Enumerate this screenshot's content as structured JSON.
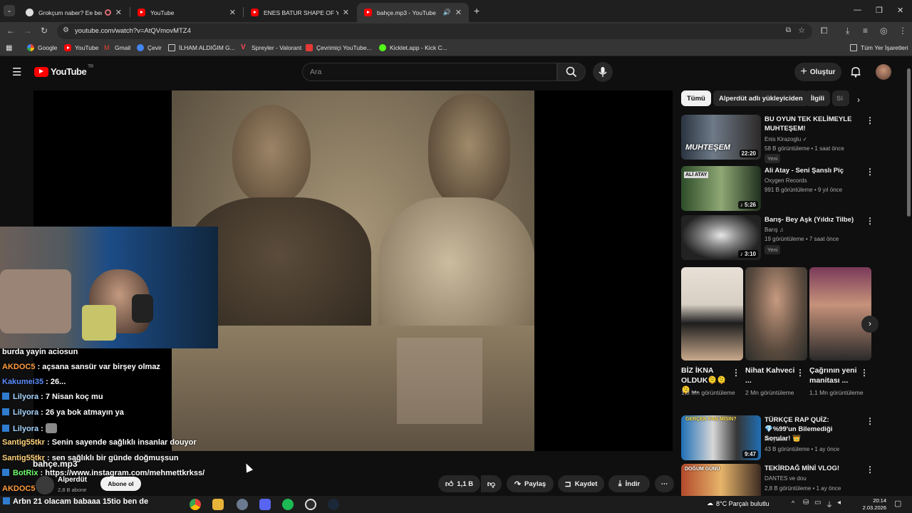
{
  "browser": {
    "tabs": [
      {
        "title": "Grokçum naber? Ee ben şim",
        "active": false
      },
      {
        "title": "YouTube",
        "active": false
      },
      {
        "title": "ENES BATUR SHAPE OF YOU RE",
        "active": false
      },
      {
        "title": "bahçe.mp3 - YouTube",
        "active": true
      }
    ],
    "url": "youtube.com/watch?v=AtQVmovMTZ4",
    "bookmarks": [
      {
        "label": "Google"
      },
      {
        "label": "YouTube"
      },
      {
        "label": "Gmail"
      },
      {
        "label": "Çevir"
      },
      {
        "label": "İLHAM ALDIĞIM G..."
      },
      {
        "label": "Spreyler - Valorant"
      },
      {
        "label": "Çevrimiçi YouTube..."
      },
      {
        "label": "Kicklet.app - Kick C..."
      }
    ],
    "all_bookmarks": "Tüm Yer İşaretleri"
  },
  "youtube": {
    "logo_text": "YouTube",
    "logo_country": "TR",
    "search_placeholder": "Ara",
    "create_label": "Oluştur"
  },
  "video": {
    "channel_title": "bahçe.mp3",
    "channel_name": "Alperdüt",
    "subscribers": "2,8 B abone",
    "subscribe_label": "Abone ol",
    "likes": "1,1 B",
    "share_label": "Paylaş",
    "save_label": "Kaydet",
    "download_label": "İndir"
  },
  "chat": [
    {
      "user": "",
      "text": "burda yayin aciosun",
      "color": "#ffffff",
      "badge": false
    },
    {
      "user": "AKDOC5",
      "text": " : açsana sansür var birşey olmaz",
      "color": "#ff9b3d",
      "badge": false
    },
    {
      "user": "Kakumei35",
      "text": " : 26...",
      "color": "#5b8cff",
      "badge": false
    },
    {
      "user": "Lilyora",
      "text": " : 7 Nisan koç mu",
      "color": "#a6d6ff",
      "badge": true
    },
    {
      "user": "Lilyora",
      "text": " : 26 ya bok atmayın ya",
      "color": "#a6d6ff",
      "badge": true
    },
    {
      "user": "Lilyora",
      "text": " : ",
      "color": "#a6d6ff",
      "badge": true
    },
    {
      "user": "Santig55tkr",
      "text": " : Senin sayende sağlıklı insanlar douyor",
      "color": "#ffd27a",
      "badge": false
    },
    {
      "user": "Santig55tkr",
      "text": " : sen sağlıklı bir günde doğmuşsun",
      "color": "#ffd27a",
      "badge": false
    },
    {
      "user": "BotRix",
      "text": " : https://www.instagram.com/mehmettkrkss/",
      "color": "#6dff6d",
      "badge": true
    },
    {
      "user": "AKDOC5",
      "text": "",
      "color": "#ff9b3d",
      "badge": false
    },
    {
      "user": "",
      "text": "Arbn 21 olacam babaaa 15tio ben de",
      "color": "#ffffff",
      "badge": true
    }
  ],
  "sidebar": {
    "chips": [
      {
        "label": "Tümü",
        "selected": true
      },
      {
        "label": "Alperdüt adlı yükleyiciden",
        "selected": false
      },
      {
        "label": "İlgili",
        "selected": false
      },
      {
        "label": "Si",
        "selected": false
      }
    ],
    "videos": [
      {
        "title": "BU OYUN TEK KELİMEYLE MUHTEŞEM!",
        "channel": "Enis Kirazoglu",
        "meta": "58 B görüntüleme • 1 saat önce",
        "duration": "22:20",
        "badge": "Yeni",
        "thumb_text": "MUHTEŞEM"
      },
      {
        "title": "Ali Atay - Seni Şanslı Piç",
        "channel": "Oxygen Records",
        "meta": "991 B görüntüleme • 9 yıl önce",
        "duration": "5:26",
        "badge": "",
        "thumb_text": "ALİ ATAY"
      },
      {
        "title": "Barış- Bey Aşk (Yıldız Tilbe)",
        "channel": "Barış",
        "meta": "19 görüntüleme • 7 saat önce",
        "duration": "3:10",
        "badge": "Yeni",
        "thumb_text": ""
      }
    ],
    "shorts": [
      {
        "title": "BİZ İKNA OLDUK🫠🫠🫠 ...",
        "views": "1,8 Mn görüntüleme"
      },
      {
        "title": "Nihat Kahveci ...",
        "views": "2 Mn görüntüleme"
      },
      {
        "title": "Çağrının yeni manitası ...",
        "views": "1,1 Mn görüntüleme"
      }
    ],
    "more_videos": [
      {
        "title": "TÜRKÇE RAP QUİZ: 💎%99'un Bilemediği Sorular! 👑",
        "channel": "Freyawie",
        "meta": "43 B görüntüleme • 1 ay önce",
        "duration": "9:47",
        "thumb_text": "GERÇEK FAN MISIN?"
      },
      {
        "title": "TEKİRDAĞ MİNİ VLOG!",
        "channel": "DANTES ve dou",
        "meta": "2,8 B görüntüleme • 1 ay önce",
        "duration": "",
        "thumb_text": "DOĞUM GÜNÜ"
      }
    ]
  },
  "taskbar": {
    "weather": "8°C  Parçalı bulutlu",
    "time": "20:14",
    "date": "2.03.2026"
  }
}
